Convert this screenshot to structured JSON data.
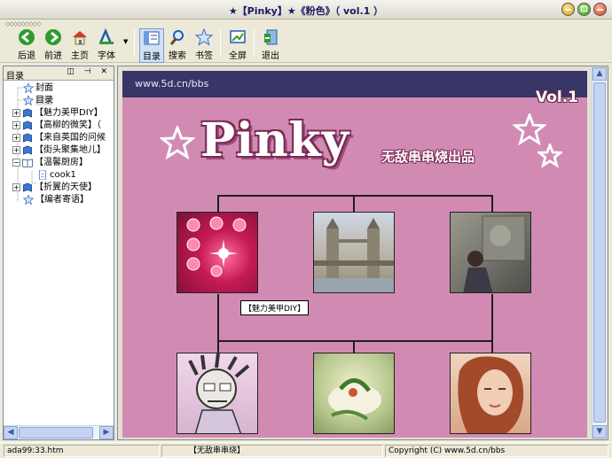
{
  "window": {
    "title": "★【Pinky】★《粉色》（ vol.1 ）"
  },
  "toolbar": {
    "buttons": [
      {
        "label": "后退",
        "icon": "back-icon"
      },
      {
        "label": "前进",
        "icon": "forward-icon"
      },
      {
        "label": "主页",
        "icon": "home-icon"
      },
      {
        "label": "字体",
        "icon": "font-icon"
      },
      {
        "label": "目录",
        "icon": "contents-icon"
      },
      {
        "label": "搜索",
        "icon": "search-icon"
      },
      {
        "label": "书签",
        "icon": "bookmark-icon"
      },
      {
        "label": "全屏",
        "icon": "fullscreen-icon"
      },
      {
        "label": "退出",
        "icon": "exit-icon"
      }
    ]
  },
  "sidebar": {
    "title": "目录",
    "header_buttons": "◫ ⊣ ✕",
    "items": [
      {
        "label": "封面"
      },
      {
        "label": "目录"
      },
      {
        "label": "【魅力美甲DIY】"
      },
      {
        "label": "【高柳的微笑】（"
      },
      {
        "label": "【来自英国的问候"
      },
      {
        "label": "【街头聚集地儿】"
      },
      {
        "label": "【温馨厨房】"
      },
      {
        "label": "cook1"
      },
      {
        "label": "【折翼的天使】"
      },
      {
        "label": "【编者寄语】"
      }
    ]
  },
  "content": {
    "bbs_url": "www.5d.cn/bbs",
    "volume": "Vol.1",
    "logo": "Pinky",
    "subtitle": "无敌串串烧出品",
    "tooltip": "【魅力美甲DIY】"
  },
  "status": {
    "left": "ada99:33.htm",
    "middle": "【无敌串串烧】",
    "right": "Copyright (C) www.5d.cn/bbs"
  },
  "colors": {
    "page_background": "#d18bb3",
    "header_bar": "#383567",
    "logo_outline": "#7a2a55"
  }
}
